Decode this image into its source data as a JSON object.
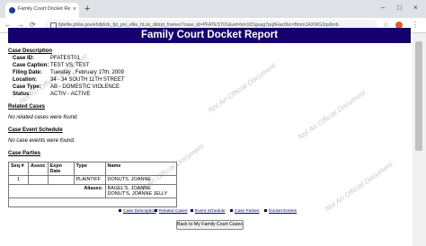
{
  "browser": {
    "tab_title": "Family Court Docket Report - Vo",
    "tab_close": "×",
    "new_tab": "+",
    "window_min": "–",
    "window_max": "□",
    "window_close": "×",
    "back": "←",
    "forward": "→",
    "reload": "⟳",
    "url": "fjdefile.phila.gov/efsfjd/zk_fjd_pnl_efile_fd.zk_dktrpt_frames?case_id=PFATEST01&uid=bm16Sguag7pq8Hac6bc=Bmm1AXWG3qs9mb",
    "star": "☆",
    "menu": "⋮"
  },
  "report": {
    "header": "Family Court Docket Report",
    "case_description": {
      "heading": "Case Description",
      "fields": [
        {
          "label": "Case ID:",
          "value": "PFATEST01"
        },
        {
          "label": "Case Caption:",
          "value": "TEST VS. TEST"
        },
        {
          "label": "Filing Date:",
          "value": "Tuesday , February 17th, 2009"
        },
        {
          "label": "Location:",
          "value": "34 - 34 SOUTH 11TH STREET"
        },
        {
          "label": "Case Type:",
          "value": "AB - DOMESTIC VIOLENCE"
        },
        {
          "label": "Status:",
          "value": "ACTIV - ACTIVE"
        }
      ]
    },
    "related_cases": {
      "heading": "Related Cases",
      "note": "No related cases were found."
    },
    "case_event_schedule": {
      "heading": "Case Event Schedule",
      "note": "No case events were found."
    },
    "case_parties": {
      "heading": "Case Parties",
      "columns": [
        "Seq #",
        "Assoc",
        "Expn Date",
        "Type",
        "Name"
      ],
      "row": {
        "seq": "1",
        "assoc": "",
        "expn_date": "",
        "type": "PLAINTIFF",
        "name": "DONUTS, JOANNE"
      },
      "aliases_label": "Aliases:",
      "aliases": [
        "BAGEL'S, JOANNE",
        "DONUT'S, JOANNE JELLY"
      ]
    },
    "bottom_links": [
      "Case Description",
      "Related Cases",
      "Event Schedule",
      "Case Parties",
      "Docket Entries"
    ],
    "back_button": "Back to My Family Court Cases",
    "watermark": "Not An Official Document"
  }
}
